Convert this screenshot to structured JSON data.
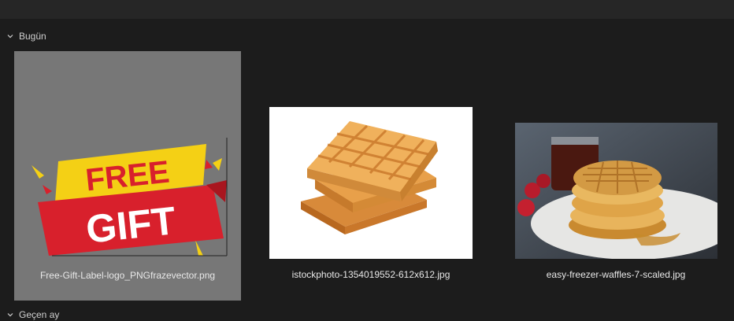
{
  "group1": {
    "label": "Bugün"
  },
  "group2": {
    "label": "Geçen ay"
  },
  "files": [
    {
      "name": "Free-Gift-Label-logo_PNGfrazevector.png",
      "thumb_badge_top": "FREE",
      "thumb_badge_bottom": "GIFT"
    },
    {
      "name": "istockphoto-1354019552-612x612.jpg"
    },
    {
      "name": "easy-freezer-waffles-7-scaled.jpg"
    }
  ],
  "colors": {
    "background": "#1c1c1c",
    "selection": "#777777",
    "badge_red": "#d8202c",
    "badge_yellow": "#f4d015"
  }
}
